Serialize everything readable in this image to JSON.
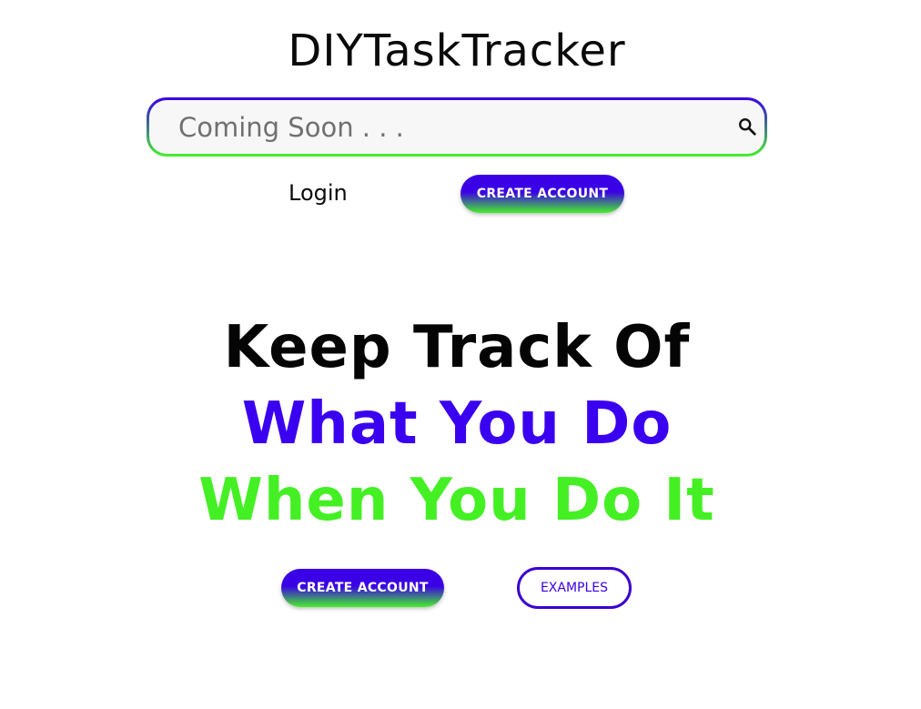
{
  "header": {
    "app_title": "DIYTaskTracker"
  },
  "search": {
    "placeholder": "Coming Soon . . .",
    "value": "",
    "icon": "search-icon"
  },
  "nav": {
    "login_label": "Login",
    "create_account_label": "CREATE ACCOUNT"
  },
  "hero": {
    "line1": "Keep Track Of",
    "line2": "What You Do",
    "line3": "When You Do It",
    "line1_color": "#050505",
    "line2_color": "#3a00f0",
    "line3_color": "#44f024"
  },
  "cta": {
    "create_account_label": "CREATE ACCOUNT",
    "examples_label": "EXAMPLES"
  },
  "colors": {
    "primary": "#3a00e6",
    "accent": "#46f02a"
  }
}
